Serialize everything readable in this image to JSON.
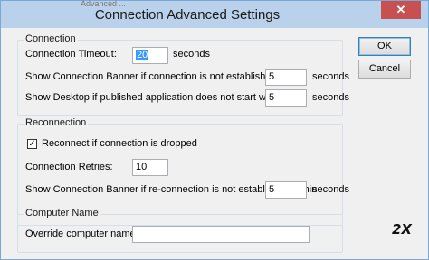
{
  "window": {
    "title": "Connection Advanced Settings",
    "close_glyph": "✕",
    "background_fragment": "Advanced ..."
  },
  "buttons": {
    "ok": "OK",
    "cancel": "Cancel"
  },
  "connection": {
    "group_label": "Connection",
    "timeout_label": "Connection Timeout:",
    "timeout_value": "20",
    "timeout_unit": "seconds",
    "banner_label": "Show Connection Banner if connection is not established within",
    "banner_value": "5",
    "banner_unit": "seconds",
    "desktop_label": "Show Desktop if published application does not start within",
    "desktop_value": "5",
    "desktop_unit": "seconds"
  },
  "reconnection": {
    "group_label": "Reconnection",
    "reconnect_label": "Reconnect if connection is dropped",
    "reconnect_checked": true,
    "retries_label": "Connection Retries:",
    "retries_value": "10",
    "banner_label": "Show Connection Banner if re-connection is not established within",
    "banner_value": "5",
    "banner_unit": "seconds"
  },
  "computer_name": {
    "group_label": "Computer Name",
    "override_label": "Override computer name:",
    "override_value": ""
  },
  "branding": {
    "logo_text": "2X"
  }
}
